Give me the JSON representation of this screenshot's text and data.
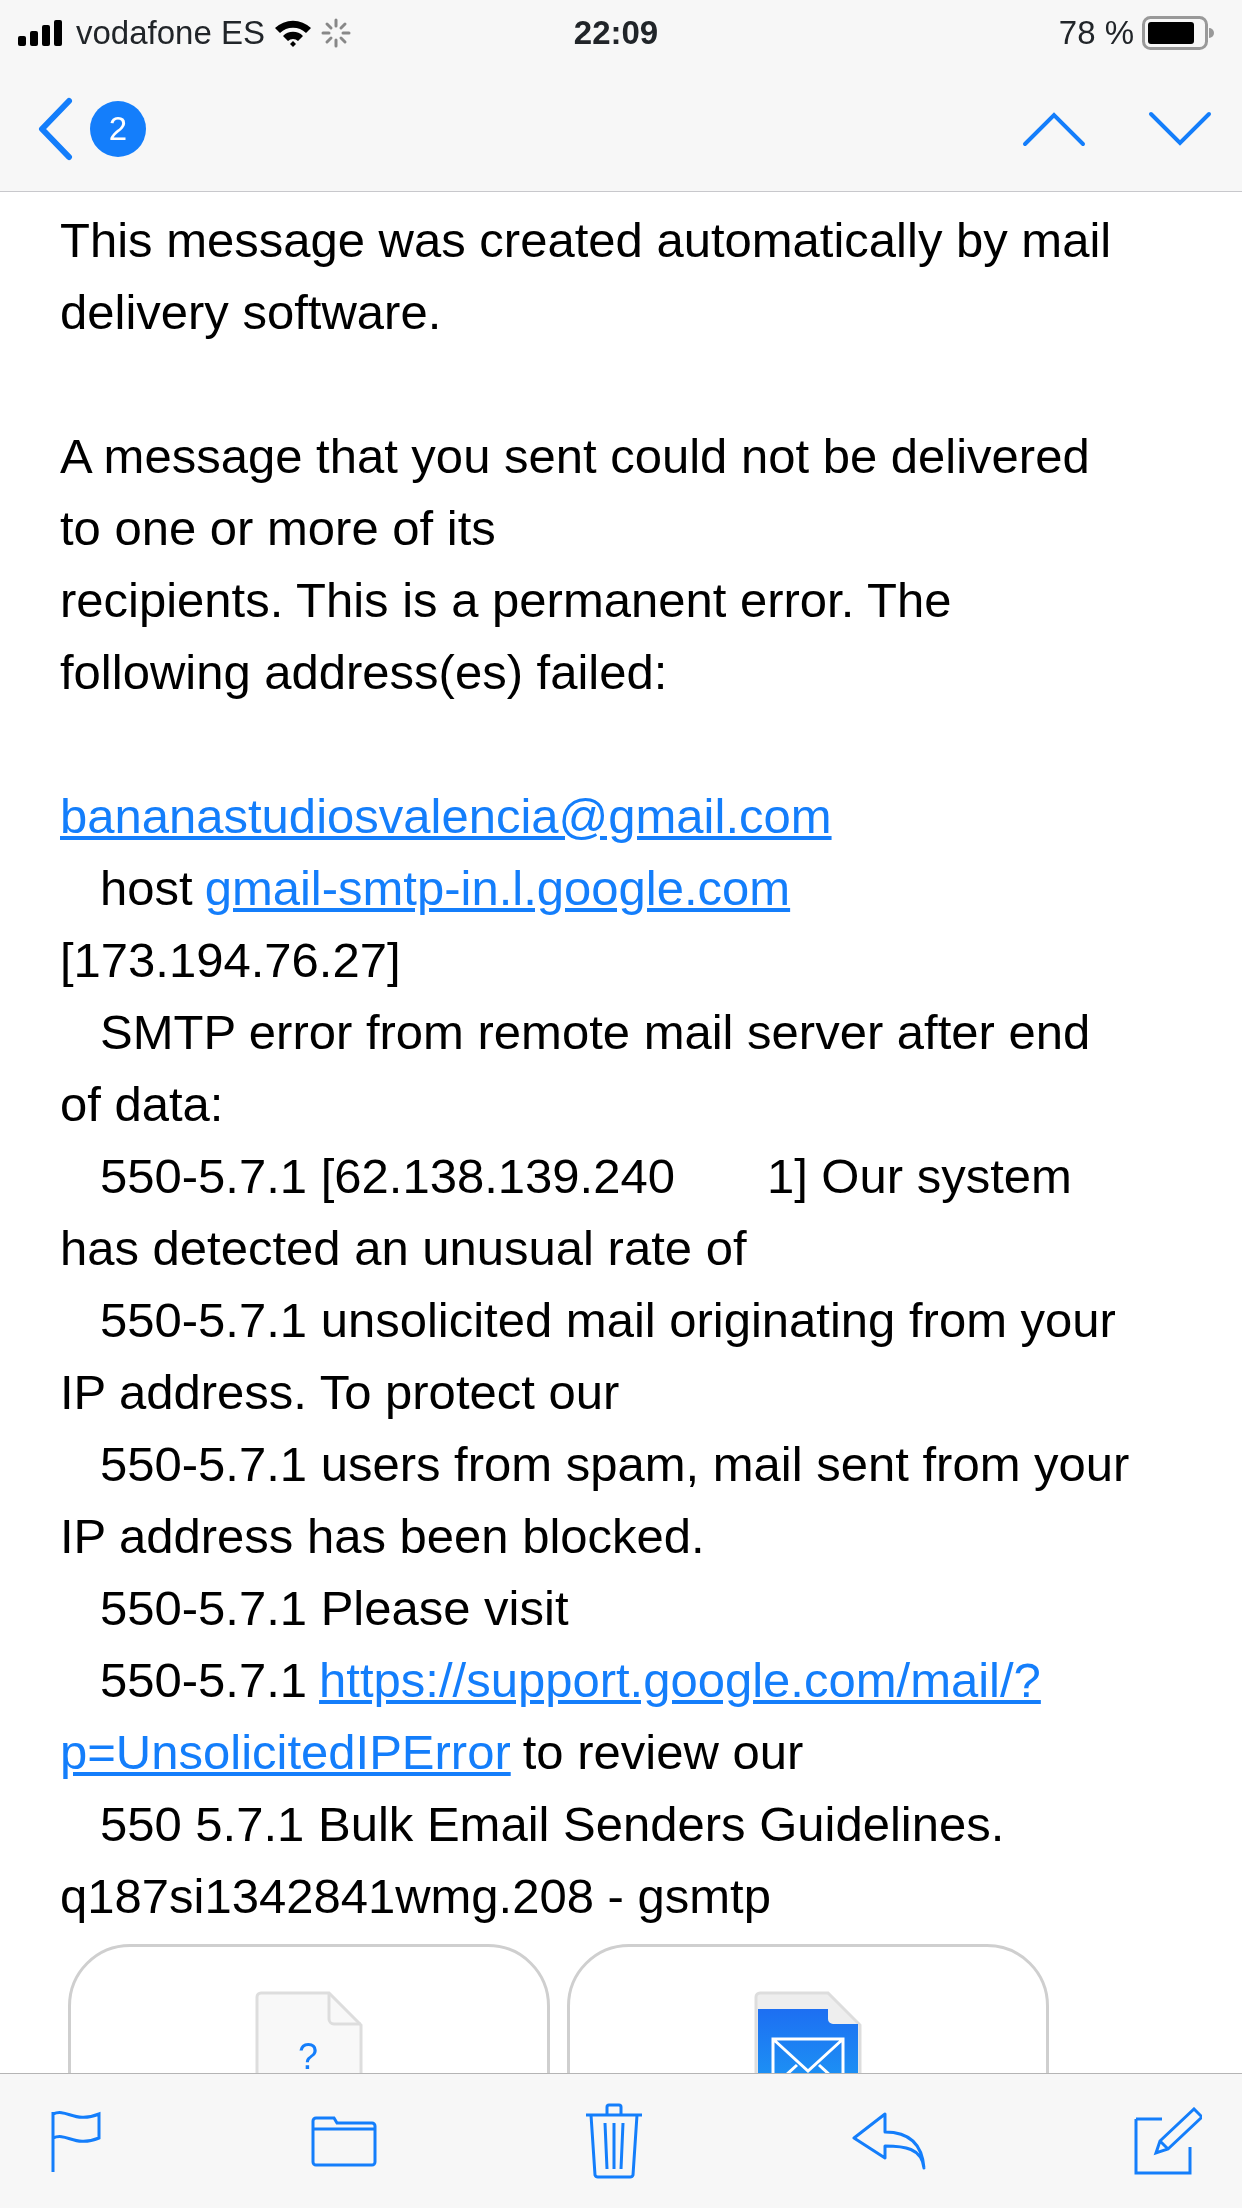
{
  "status_bar": {
    "carrier": "vodafone ES",
    "time": "22:09",
    "battery": "78 %"
  },
  "nav": {
    "unread_count": "2"
  },
  "body": [
    [
      {
        "parts": [
          {
            "text": "This message was created automatically by mail"
          }
        ]
      },
      {
        "parts": [
          {
            "text": "delivery software."
          }
        ]
      }
    ],
    [
      {
        "parts": [
          {
            "text": "A message that you sent could not be delivered"
          }
        ]
      },
      {
        "parts": [
          {
            "text": "to one or more of its"
          }
        ]
      },
      {
        "parts": [
          {
            "text": "recipients. This is a permanent error. The"
          }
        ]
      },
      {
        "parts": [
          {
            "text": "following address(es) failed:"
          }
        ]
      }
    ],
    [
      {
        "parts": [
          {
            "text": "bananastudiosvalencia@gmail.com",
            "link": true
          }
        ]
      },
      {
        "indent": true,
        "parts": [
          {
            "text": "host"
          },
          {
            "text": "gmail-smtp-in.l.google.com",
            "link": true
          }
        ]
      },
      {
        "parts": [
          {
            "text": "[173.194.76.27]"
          }
        ]
      },
      {
        "indent": true,
        "parts": [
          {
            "text": "SMTP error from remote mail server after end"
          }
        ]
      },
      {
        "parts": [
          {
            "text": "of data:"
          }
        ]
      },
      {
        "indent": true,
        "parts": [
          {
            "text": "550-5.7.1 [62.138.139.240"
          },
          {
            "text": "1] Our system",
            "gap": true
          }
        ]
      },
      {
        "parts": [
          {
            "text": "has detected an unusual rate of"
          }
        ]
      },
      {
        "indent": true,
        "parts": [
          {
            "text": "550-5.7.1 unsolicited mail originating from your"
          }
        ]
      },
      {
        "parts": [
          {
            "text": "IP address. To protect our"
          }
        ]
      },
      {
        "indent": true,
        "parts": [
          {
            "text": "550-5.7.1 users from spam, mail sent from your"
          }
        ]
      },
      {
        "parts": [
          {
            "text": "IP address has been blocked."
          }
        ]
      },
      {
        "indent": true,
        "parts": [
          {
            "text": "550-5.7.1 Please visit"
          }
        ]
      },
      {
        "indent": true,
        "parts": [
          {
            "text": "550-5.7.1"
          },
          {
            "text": "https://support.google.com/mail/?",
            "link": true
          }
        ]
      },
      {
        "parts": [
          {
            "text": "p=UnsolicitedIPError",
            "link": true
          },
          {
            "text": "to review our"
          }
        ]
      },
      {
        "indent": true,
        "parts": [
          {
            "text": "550 5.7.1 Bulk Email Senders Guidelines."
          }
        ]
      },
      {
        "parts": [
          {
            "text": "q187si1342841wmg.208 - gsmtp"
          }
        ]
      }
    ]
  ],
  "attachments": [
    {
      "kind": "unknown",
      "glyph": "?"
    },
    {
      "kind": "mail"
    }
  ]
}
